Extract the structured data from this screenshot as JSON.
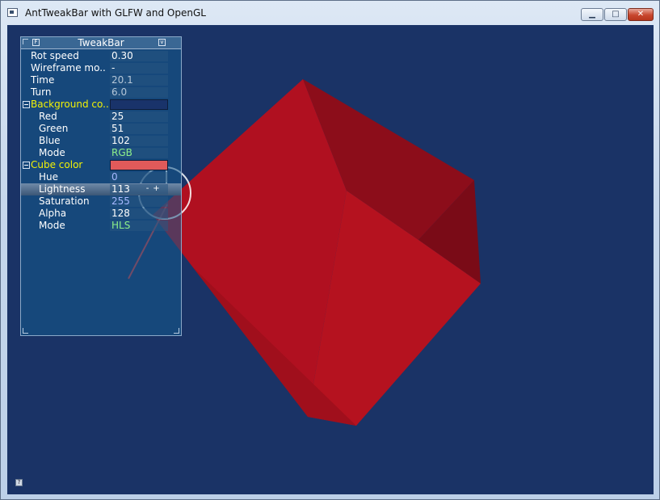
{
  "window": {
    "title": "AntTweakBar with GLFW and OpenGL",
    "icons": {
      "app": "app-window-icon",
      "minimize": "minimize-icon",
      "maximize": "maximize-icon",
      "close": "close-icon"
    }
  },
  "tweakbar": {
    "title": "TweakBar",
    "rows": [
      {
        "label": "Rot speed",
        "value": "0.30",
        "style": "normal"
      },
      {
        "label": "Wireframe mo..",
        "value": "-",
        "style": "normal"
      },
      {
        "label": "Time",
        "value": "20.1",
        "style": "readonly"
      },
      {
        "label": "Turn",
        "value": "6.0",
        "style": "readonly"
      },
      {
        "label": "Background co..",
        "color": "#19336a",
        "group": true
      },
      {
        "label": "Red",
        "value": "25",
        "style": "normal"
      },
      {
        "label": "Green",
        "value": "51",
        "style": "normal"
      },
      {
        "label": "Blue",
        "value": "102",
        "style": "normal"
      },
      {
        "label": "Mode",
        "value": "RGB",
        "style": "green"
      },
      {
        "label": "Cube color",
        "color": "#e05a5a",
        "group": true
      },
      {
        "label": "Hue",
        "value": "0",
        "style": "blue"
      },
      {
        "label": "Lightness",
        "value": "113",
        "style": "normal",
        "selected": true
      },
      {
        "label": "Saturation",
        "value": "255",
        "style": "blue"
      },
      {
        "label": "Alpha",
        "value": "128",
        "style": "normal"
      },
      {
        "label": "Mode",
        "value": "HLS",
        "style": "green"
      }
    ],
    "spin_minus": "-",
    "spin_plus": "+"
  },
  "scene": {
    "background": "#1a3366",
    "cube_color": "#b01020"
  }
}
